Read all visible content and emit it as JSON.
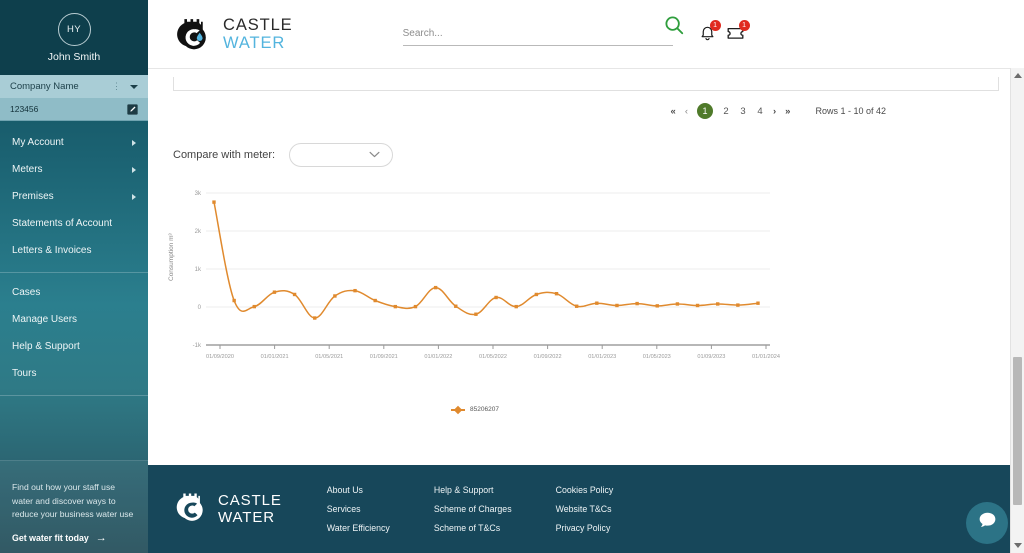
{
  "sidebar": {
    "avatar_initials": "HY",
    "user_name": "John Smith",
    "company_name": "Company Name",
    "account_number": "123456",
    "nav_items": [
      {
        "label": "My Account",
        "has_children": true
      },
      {
        "label": "Meters",
        "has_children": true
      },
      {
        "label": "Premises",
        "has_children": true
      },
      {
        "label": "Statements of Account",
        "has_children": false
      },
      {
        "label": "Letters & Invoices",
        "has_children": false
      }
    ],
    "nav_items_secondary": [
      {
        "label": "Cases"
      },
      {
        "label": "Manage Users"
      },
      {
        "label": "Help & Support"
      },
      {
        "label": "Tours"
      }
    ],
    "promo": {
      "text": "Find out how your staff use water and discover ways to reduce your business water use",
      "cta": "Get water fit today",
      "cta_arrow": "→"
    }
  },
  "header": {
    "logo_line1": "CASTLE",
    "logo_line2": "WATER",
    "search_placeholder": "Search...",
    "search_value": "",
    "notification_badge": "1",
    "tickets_badge": "1"
  },
  "pagination": {
    "first": "«",
    "prev": "‹",
    "pages": [
      "1",
      "2",
      "3",
      "4"
    ],
    "active_page": "1",
    "next": "›",
    "last": "»",
    "rows_info": "Rows 1 - 10 of 42"
  },
  "compare": {
    "label": "Compare with meter:",
    "selected_value": "",
    "chevron": "⌄"
  },
  "footer": {
    "logo_line1": "CASTLE",
    "logo_line2": "WATER",
    "columns": [
      {
        "links": [
          "About Us",
          "Services",
          "Water Efficiency"
        ]
      },
      {
        "links": [
          "Help & Support",
          "Scheme of Charges",
          "Scheme of T&Cs"
        ]
      },
      {
        "links": [
          "Cookies Policy",
          "Website T&Cs",
          "Privacy Policy"
        ]
      }
    ]
  },
  "colors": {
    "series": "#e08a2e",
    "sidebar_top": "#0e3f4c",
    "footer_bg": "#17475a",
    "accent_green": "#4f7a2a",
    "logo_blue": "#53b4de",
    "badge_red": "#e02b20",
    "chat_bg": "#2c7386"
  },
  "chart_data": {
    "type": "line",
    "title": "",
    "xlabel": "",
    "ylabel": "Consumption m³",
    "ylim": [
      -1000,
      3000
    ],
    "ytick_labels": [
      "3k",
      "2k",
      "1k",
      "0",
      "-1k"
    ],
    "ytick_values": [
      3000,
      2000,
      1000,
      0,
      -1000
    ],
    "xtick_labels": [
      "01/09/2020",
      "01/01/2021",
      "01/05/2021",
      "01/09/2021",
      "01/01/2022",
      "01/05/2022",
      "01/09/2022",
      "01/01/2023",
      "01/05/2023",
      "01/09/2023",
      "01/01/2024"
    ],
    "grid": true,
    "legend_position": "bottom",
    "series": [
      {
        "name": "85206207",
        "color": "#e08a2e",
        "marker": "square",
        "points": [
          {
            "x": "01/08/2020",
            "y": 2760
          },
          {
            "x": "01/11/2020",
            "y": 170
          },
          {
            "x": "01/12/2020",
            "y": 10
          },
          {
            "x": "01/03/2021",
            "y": 390
          },
          {
            "x": "01/05/2021",
            "y": 330
          },
          {
            "x": "01/06/2021",
            "y": -290
          },
          {
            "x": "01/09/2021",
            "y": 290
          },
          {
            "x": "01/12/2021",
            "y": 430
          },
          {
            "x": "01/01/2022",
            "y": 170
          },
          {
            "x": "01/02/2022",
            "y": 10
          },
          {
            "x": "01/06/2022",
            "y": 10
          },
          {
            "x": "01/08/2022",
            "y": 510
          },
          {
            "x": "01/09/2022",
            "y": 20
          },
          {
            "x": "01/10/2022",
            "y": -190
          },
          {
            "x": "01/01/2023",
            "y": 250
          },
          {
            "x": "01/04/2023",
            "y": 10
          },
          {
            "x": "01/05/2023",
            "y": 330
          },
          {
            "x": "01/08/2023",
            "y": 350
          },
          {
            "x": "01/09/2023",
            "y": 20
          },
          {
            "x": "01/10/2023",
            "y": 100
          },
          {
            "x": "01/10/2023b",
            "y": 40
          },
          {
            "x": "01/11/2023",
            "y": 90
          },
          {
            "x": "01/11/2023b",
            "y": 30
          },
          {
            "x": "01/12/2023",
            "y": 80
          },
          {
            "x": "01/12/2023b",
            "y": 40
          },
          {
            "x": "01/01/2024",
            "y": 80
          },
          {
            "x": "01/01/2024b",
            "y": 50
          },
          {
            "x": "01/02/2024",
            "y": 100
          }
        ]
      }
    ]
  }
}
